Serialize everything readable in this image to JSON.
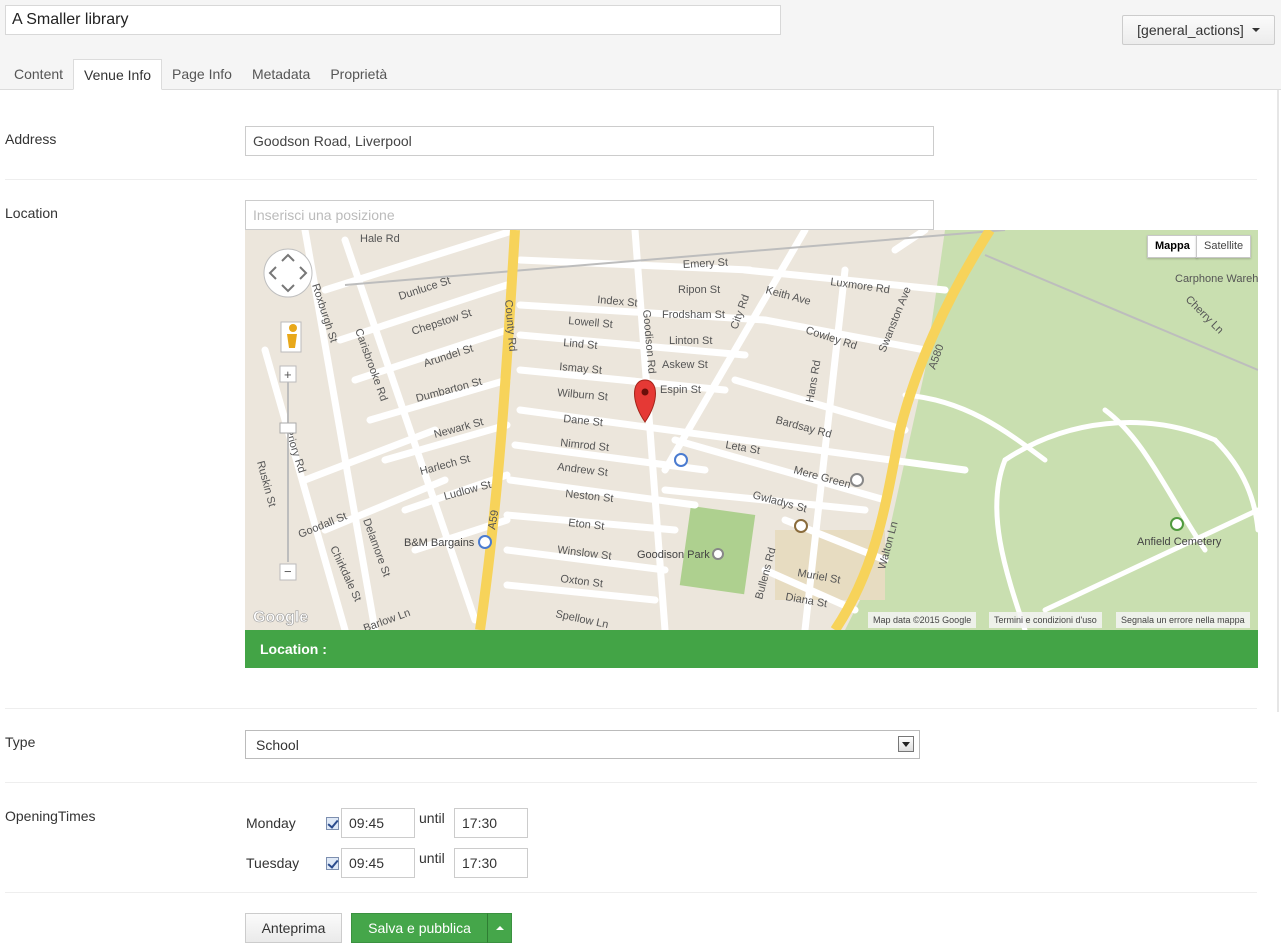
{
  "header": {
    "title_value": "A Smaller library",
    "actions_label": "[general_actions]"
  },
  "tabs": [
    {
      "label": "Content"
    },
    {
      "label": "Venue Info"
    },
    {
      "label": "Page Info"
    },
    {
      "label": "Metadata"
    },
    {
      "label": "Proprietà"
    }
  ],
  "address": {
    "label": "Address",
    "value": "Goodson Road, Liverpool"
  },
  "location": {
    "label": "Location",
    "placeholder": "Inserisci una posizione",
    "bar_text": "Location :"
  },
  "map": {
    "type_map": "Mappa",
    "type_satellite": "Satellite",
    "attribution": "Map data ©2015 Google",
    "terms": "Termini e condizioni d'uso",
    "report": "Segnala un errore nella mappa",
    "logo": "Google",
    "streets": [
      "Hale Rd",
      "Emery St",
      "Luxmore Rd",
      "Dunluce St",
      "Index St",
      "Ripon St",
      "Keith Ave",
      "Chepstow St",
      "Lowell St",
      "Frodsham St",
      "Cowley Rd",
      "Swanston Ave",
      "Arundel St",
      "Lind St",
      "Linton St",
      "Ismay St",
      "Askew St",
      "Dumbarton St",
      "Wilburn St",
      "Espin St",
      "Bardsay Rd",
      "Newark St",
      "Dane St",
      "Nimrod St",
      "Leta St",
      "Harlech St",
      "Andrew St",
      "Mere Green",
      "Ludlow St",
      "Neston St",
      "Gwladys St",
      "Eton St",
      "Goodall St",
      "Winslow St",
      "Oxton St",
      "Spellow Ln",
      "Muriel St",
      "Diana St",
      "County Rd",
      "A59",
      "Walton Ln",
      "A580",
      "Goodison Rd",
      "City Rd",
      "Hans Rd",
      "Bullens Rd",
      "Carisbrooke Rd",
      "Roxburgh St",
      "Delamore St",
      "Chirkdale St",
      "Ruskin St",
      "Barlow Ln",
      "Cherry Ln",
      "Carphone Wareh",
      "Walton Ln",
      "Priory Rd",
      "Gwladys St",
      "Nimrod St"
    ],
    "places": [
      "B&M Bargains",
      "Goodison Park",
      "Anfield Cemetery"
    ]
  },
  "type": {
    "label": "Type",
    "value": "School"
  },
  "opening": {
    "label": "OpeningTimes",
    "until_label": "until",
    "days": [
      {
        "day": "Monday",
        "from": "09:45",
        "to": "17:30",
        "checked": true
      },
      {
        "day": "Tuesday",
        "from": "09:45",
        "to": "17:30",
        "checked": true
      }
    ]
  },
  "buttons": {
    "preview": "Anteprima",
    "save_publish": "Salva e pubblica"
  },
  "colors": {
    "accent_green": "#43a446",
    "map_road_major": "#f7d35a",
    "map_park": "#c9dfb0"
  }
}
